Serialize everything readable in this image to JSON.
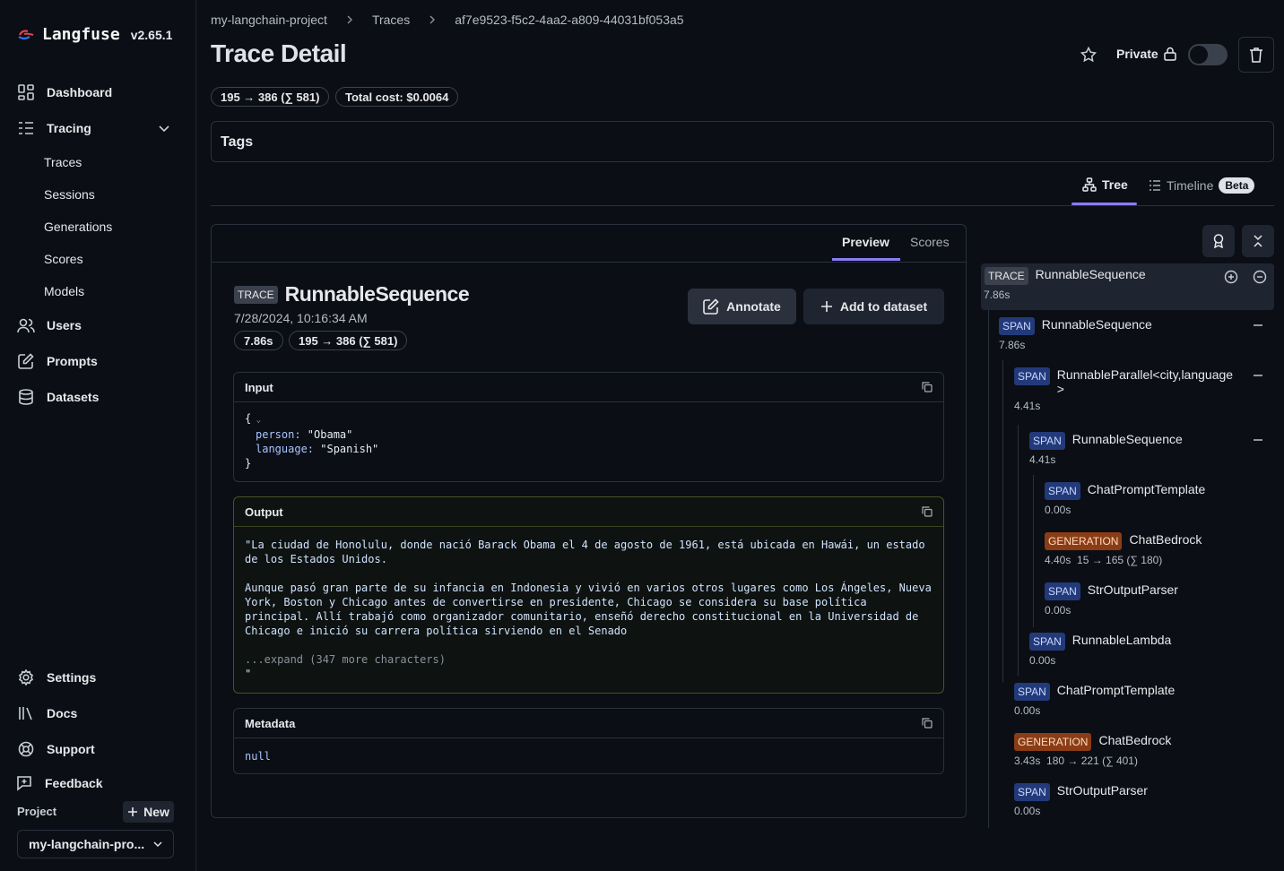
{
  "app": {
    "name": "Langfuse",
    "version": "v2.65.1"
  },
  "sidebar": {
    "dashboard": "Dashboard",
    "tracing": "Tracing",
    "sub": [
      "Traces",
      "Sessions",
      "Generations",
      "Scores",
      "Models"
    ],
    "users": "Users",
    "prompts": "Prompts",
    "datasets": "Datasets",
    "settings": "Settings",
    "docs": "Docs",
    "support": "Support",
    "feedback": "Feedback",
    "project_label": "Project",
    "new_label": "New",
    "project_name": "my-langchain-pro..."
  },
  "breadcrumb": [
    "my-langchain-project",
    "Traces",
    "af7e9523-f5c2-4aa2-a809-44031bf053a5"
  ],
  "header": {
    "title": "Trace Detail",
    "private_label": "Private",
    "tokens_pill": "195 → 386 (∑ 581)",
    "cost_pill": "Total cost: $0.0064"
  },
  "tags_label": "Tags",
  "view_tabs": {
    "tree": "Tree",
    "timeline": "Timeline",
    "beta": "Beta"
  },
  "panel": {
    "tabs": {
      "preview": "Preview",
      "scores": "Scores"
    },
    "badge": "TRACE",
    "name": "RunnableSequence",
    "timestamp": "7/28/2024, 10:16:34 AM",
    "latency_pill": "7.86s",
    "tokens_pill": "195 → 386 (∑ 581)",
    "annotate": "Annotate",
    "add_to_dataset": "Add to dataset",
    "input": {
      "label": "Input",
      "open": "{",
      "line1_key": "person: ",
      "line1_val": "\"Obama\"",
      "line2_key": "language: ",
      "line2_val": "\"Spanish\"",
      "close": "}"
    },
    "output": {
      "label": "Output",
      "p1": "\"La ciudad de Honolulu, donde nació Barack Obama el 4 de agosto de 1961, está ubicada en Hawái, un estado de los Estados Unidos.",
      "p2": "Aunque pasó gran parte de su infancia en Indonesia y vivió en varios otros lugares como Los Ángeles, Nueva York, Boston y Chicago antes de convertirse en presidente, Chicago se considera su base política principal. Allí trabajó como organizador comunitario, enseñó derecho constitucional en la Universidad de Chicago e inició su carrera política sirviendo en el Senado",
      "expand": "...expand (347 more characters)",
      "end": "\""
    },
    "metadata": {
      "label": "Metadata",
      "value": "null"
    }
  },
  "tree": [
    {
      "badge": "TRACE",
      "name": "RunnableSequence",
      "meta": "7.86s"
    },
    {
      "badge": "SPAN",
      "name": "RunnableSequence",
      "meta": "7.86s"
    },
    {
      "badge": "SPAN",
      "name": "RunnableParallel<city,language",
      "name2": ">",
      "meta": "4.41s"
    },
    {
      "badge": "SPAN",
      "name": "RunnableSequence",
      "meta": "4.41s"
    },
    {
      "badge": "SPAN",
      "name": "ChatPromptTemplate",
      "meta": "0.00s"
    },
    {
      "badge": "GENERATION",
      "name": "ChatBedrock",
      "meta": "4.40s",
      "tokens": "15 → 165 (∑ 180)"
    },
    {
      "badge": "SPAN",
      "name": "StrOutputParser",
      "meta": "0.00s"
    },
    {
      "badge": "SPAN",
      "name": "RunnableLambda",
      "meta": "0.00s"
    },
    {
      "badge": "SPAN",
      "name": "ChatPromptTemplate",
      "meta": "0.00s"
    },
    {
      "badge": "GENERATION",
      "name": "ChatBedrock",
      "meta": "3.43s",
      "tokens": "180 → 221 (∑ 401)"
    },
    {
      "badge": "SPAN",
      "name": "StrOutputParser",
      "meta": "0.00s"
    }
  ],
  "colors": {
    "accent": "#8b7cf6",
    "span": "#233a7a",
    "generation": "#8a3d15"
  }
}
